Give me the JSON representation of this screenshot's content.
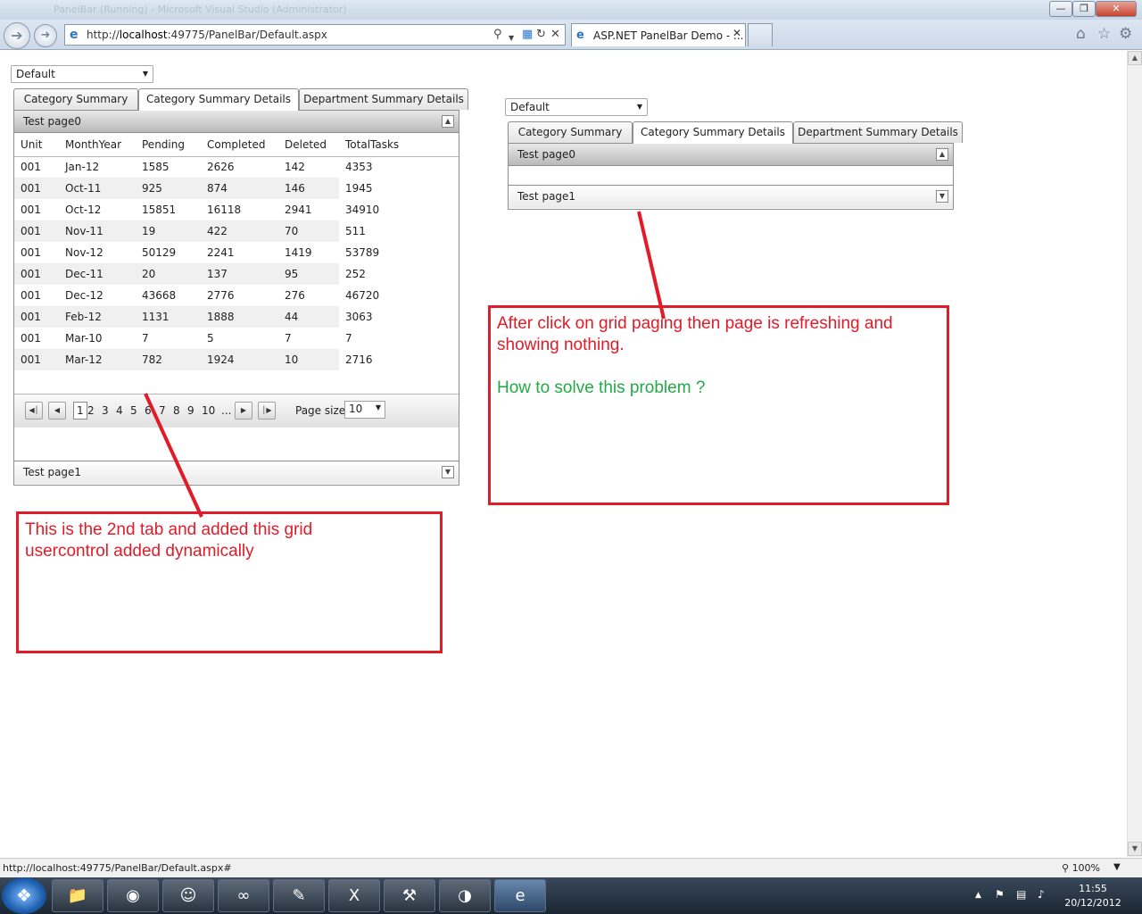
{
  "browser": {
    "title_ghost": "PanelBar (Running) - Microsoft Visual Studio (Administrator)",
    "window_controls": [
      "minimize",
      "maximize",
      "close"
    ],
    "address": {
      "prefix": "http://",
      "host": "localhost",
      "rest": ":49775/PanelBar/Default.aspx"
    },
    "tab_title": "ASP.NET PanelBar Demo - ...",
    "status_text": "http://localhost:49775/PanelBar/Default.aspx#",
    "zoom": "100%"
  },
  "left_panel": {
    "skin_select": "Default",
    "tabs": [
      "Category Summary",
      "Category Summary Details",
      "Department Summary Details"
    ],
    "selected_tab": 1,
    "item0": "Test page0",
    "item1": "Test page1",
    "grid": {
      "columns": [
        "Unit",
        "MonthYear",
        "Pending",
        "Completed",
        "Deleted",
        "TotalTasks"
      ],
      "rows": [
        [
          "001",
          "Jan-12",
          "1585",
          "2626",
          "142",
          "4353"
        ],
        [
          "001",
          "Oct-11",
          "925",
          "874",
          "146",
          "1945"
        ],
        [
          "001",
          "Oct-12",
          "15851",
          "16118",
          "2941",
          "34910"
        ],
        [
          "001",
          "Nov-11",
          "19",
          "422",
          "70",
          "511"
        ],
        [
          "001",
          "Nov-12",
          "50129",
          "2241",
          "1419",
          "53789"
        ],
        [
          "001",
          "Dec-11",
          "20",
          "137",
          "95",
          "252"
        ],
        [
          "001",
          "Dec-12",
          "43668",
          "2776",
          "276",
          "46720"
        ],
        [
          "001",
          "Feb-12",
          "1131",
          "1888",
          "44",
          "3063"
        ],
        [
          "001",
          "Mar-10",
          "7",
          "5",
          "7",
          "7"
        ],
        [
          "001",
          "Mar-12",
          "782",
          "1924",
          "10",
          "2716"
        ]
      ],
      "pager": {
        "pages": [
          "1",
          "2",
          "3",
          "4",
          "5",
          "6",
          "7",
          "8",
          "9",
          "10",
          "..."
        ],
        "current": "1",
        "page_size_label": "Page size:",
        "page_size": "10"
      }
    }
  },
  "right_panel": {
    "skin_select": "Default",
    "tabs": [
      "Category Summary",
      "Category Summary Details",
      "Department Summary Details"
    ],
    "selected_tab": 1,
    "item0": "Test page0",
    "item1": "Test page1"
  },
  "annotations": {
    "left": {
      "line1": "This is the 2nd tab and added this grid",
      "line2": "usercontrol added dynamically"
    },
    "right": {
      "line1": "After click on grid paging then page is refreshing and",
      "line2": "showing nothing.",
      "question": "How to solve this problem ?"
    },
    "color_red": "#e21b28",
    "color_green": "#22aa44"
  },
  "taskbar": {
    "apps": [
      "explorer",
      "firefox",
      "messenger",
      "visual-studio",
      "project",
      "excel",
      "tools",
      "paint",
      "internet-explorer"
    ],
    "clock_time": "11:55",
    "clock_date": "20/12/2012"
  }
}
